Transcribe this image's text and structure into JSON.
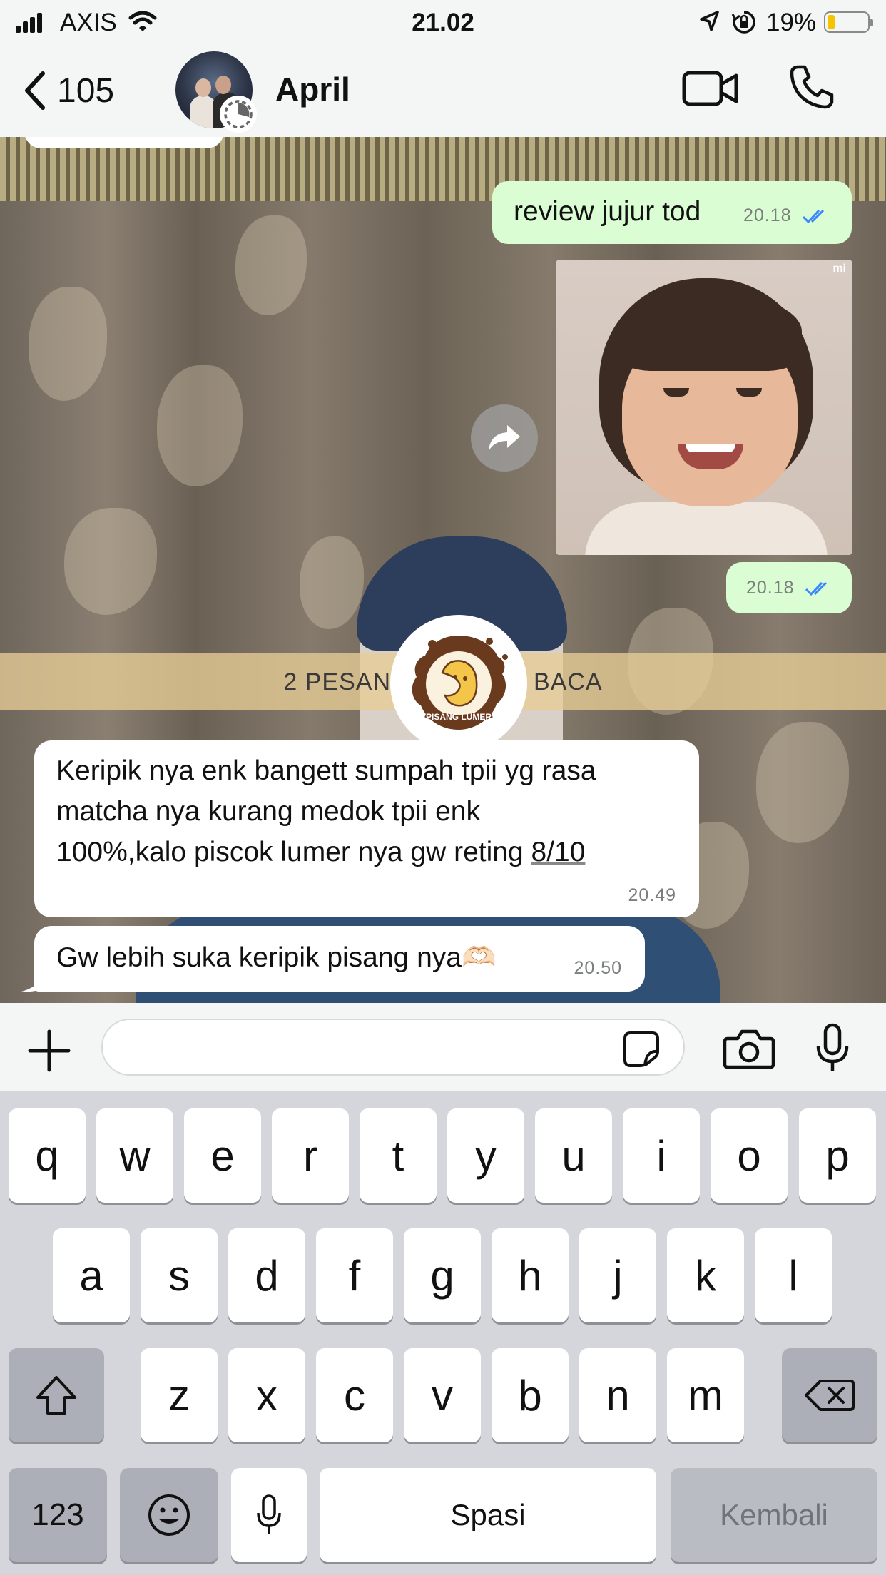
{
  "status_bar": {
    "carrier": "AXIS",
    "time": "21.02",
    "battery_percent": "19%",
    "battery_level": 0.19,
    "battery_color": "#f4c400",
    "icons": [
      "signal-bars-icon",
      "wifi-icon",
      "location-arrow-icon",
      "orientation-lock-icon",
      "battery-icon"
    ]
  },
  "header": {
    "back_count": "105",
    "contact_name": "April",
    "icons": [
      "chevron-left-icon",
      "disappearing-timer-icon",
      "video-camera-icon",
      "phone-icon"
    ]
  },
  "messages": [
    {
      "id": "m1",
      "direction": "outgoing",
      "type": "text",
      "text": "review jujur tod",
      "time": "20.18",
      "status": "read"
    },
    {
      "id": "m2",
      "direction": "outgoing",
      "type": "image",
      "watermark": "mi",
      "time": "20.18",
      "status": "read"
    },
    {
      "id": "m3",
      "direction": "incoming",
      "type": "text",
      "text_lines": [
        "Keripik nya enk bangett sumpah tpii yg rasa",
        "matcha nya kurang medok tpii enk",
        "100%,kalo piscok lumer nya gw reting "
      ],
      "text_link": "8/10",
      "time": "20.49"
    },
    {
      "id": "m4",
      "direction": "incoming",
      "type": "text",
      "text": "Gw lebih suka keripik pisang nya🫶🏻",
      "time": "20.50"
    }
  ],
  "unread_banner": {
    "left": "2 PESAN",
    "right": "BACA"
  },
  "sticker": {
    "text": "PISANG LUMER"
  },
  "composer": {
    "input_value": "",
    "icons": [
      "plus-icon",
      "sticker-icon",
      "camera-icon",
      "microphone-icon"
    ]
  },
  "keyboard": {
    "row1": [
      "q",
      "w",
      "e",
      "r",
      "t",
      "y",
      "u",
      "i",
      "o",
      "p"
    ],
    "row2": [
      "a",
      "s",
      "d",
      "f",
      "g",
      "h",
      "j",
      "k",
      "l"
    ],
    "row3": [
      "z",
      "x",
      "c",
      "v",
      "b",
      "n",
      "m"
    ],
    "numbers_key": "123",
    "space_key": "Spasi",
    "return_key": "Kembali",
    "icons": [
      "shift-icon",
      "backspace-icon",
      "emoji-icon",
      "dictation-mic-icon"
    ]
  },
  "colors": {
    "outgoing_bubble": "#dafdd3",
    "incoming_bubble": "#ffffff",
    "read_ticks": "#3a86ff",
    "unread_banner": "#e7cd96",
    "keyboard_bg": "#d4d6dc"
  }
}
